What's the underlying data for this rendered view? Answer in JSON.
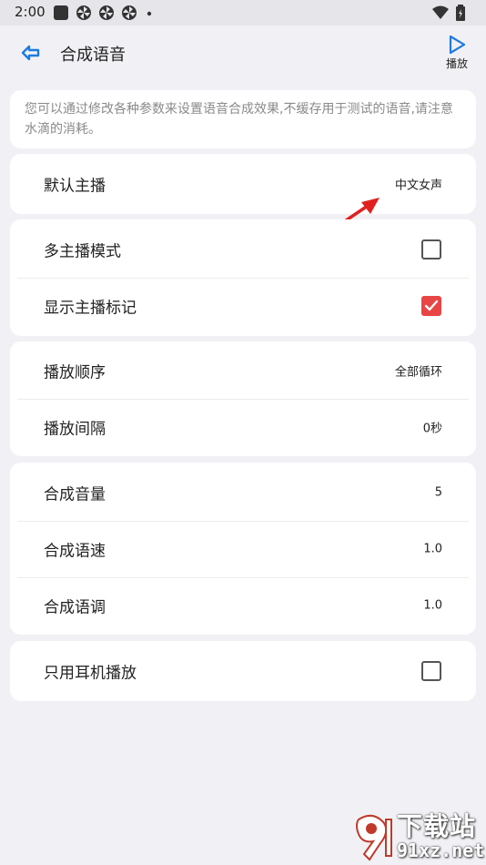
{
  "status_bar": {
    "time": "2:00",
    "icons": [
      "app-notification-icon",
      "pinwheel-icon",
      "pinwheel-icon",
      "pinwheel-icon",
      "dot-icon"
    ],
    "right_icons": [
      "wifi-icon",
      "battery-icon"
    ]
  },
  "app_bar": {
    "title": "合成语音",
    "back_icon": "back-arrow-icon",
    "play_label": "播放",
    "play_icon": "play-icon",
    "accent_color": "#1e7be0"
  },
  "description": "您可以通过修改各种参数来设置语音合成效果,不缓存用于测试的语音,请注意水滴的消耗。",
  "settings": {
    "default_anchor": {
      "label": "默认主播",
      "value": "中文女声"
    },
    "multi_anchor_mode": {
      "label": "多主播模式",
      "checked": false
    },
    "show_anchor_mark": {
      "label": "显示主播标记",
      "checked": true
    },
    "play_order": {
      "label": "播放顺序",
      "value": "全部循环"
    },
    "play_interval": {
      "label": "播放间隔",
      "value": "0秒"
    },
    "volume": {
      "label": "合成音量",
      "value": "5"
    },
    "speed": {
      "label": "合成语速",
      "value": "1.0"
    },
    "pitch": {
      "label": "合成语调",
      "value": "1.0"
    },
    "headphone_only": {
      "label": "只用耳机播放",
      "checked": false
    }
  },
  "checkbox_checked_color": "#e84545",
  "annotation_arrow_color": "#e02020",
  "watermark": {
    "line1": "下载站",
    "line2": "91xz.net"
  }
}
